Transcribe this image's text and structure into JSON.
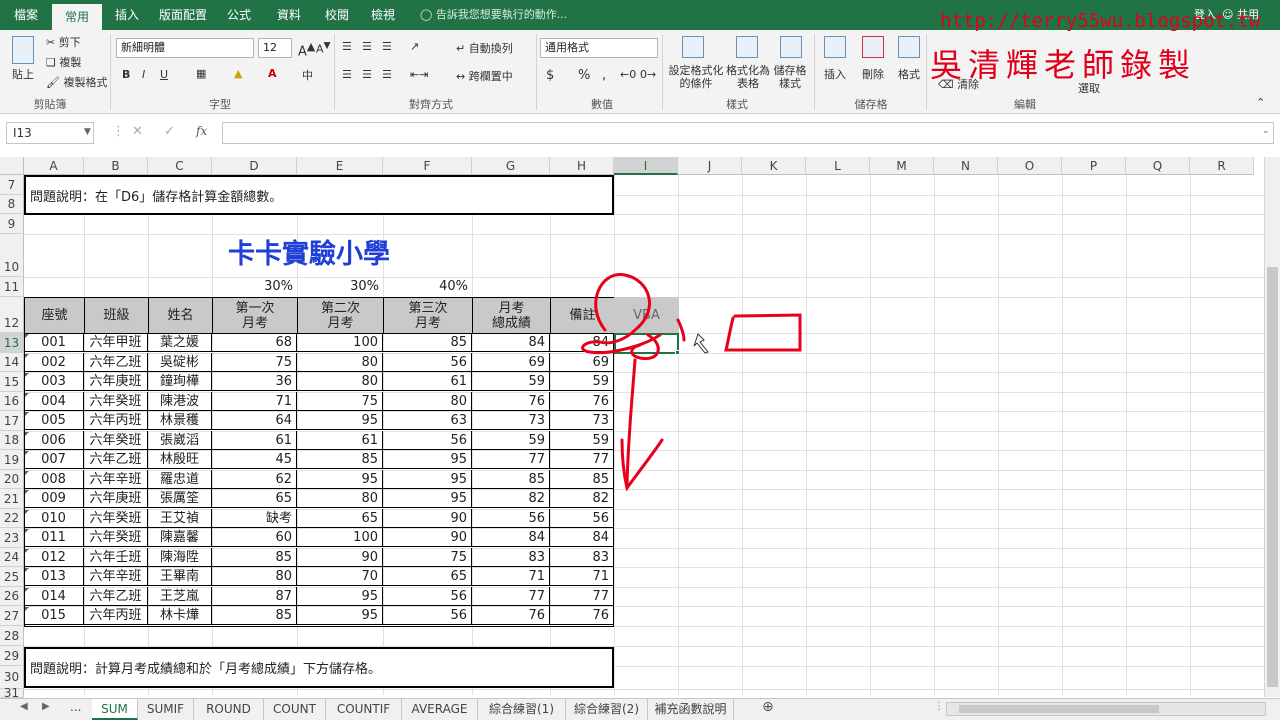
{
  "tabs": [
    "檔案",
    "常用",
    "插入",
    "版面配置",
    "公式",
    "資料",
    "校閱",
    "檢視"
  ],
  "active_tab": "常用",
  "tell_me": "告訴我您想要執行的動作...",
  "login": "登入",
  "share": "共用",
  "watermark_url": "http://terry55wu.blogspot.tw",
  "watermark_name": "吳清輝老師錄製",
  "ribbon": {
    "paste": "貼上",
    "cut": "剪下",
    "copy": "複製",
    "format_painter": "複製格式",
    "clipboard": "剪貼簿",
    "font_name": "新細明體",
    "font_size": "12",
    "font_group": "字型",
    "wrap": "自動換列",
    "merge": "跨欄置中",
    "align_group": "對齊方式",
    "num_format": "通用格式",
    "num_group": "數值",
    "cond_format": "設定格式化的條件",
    "table_format": "格式化為表格",
    "cell_style": "儲存格樣式",
    "style_group": "樣式",
    "insert": "插入",
    "delete": "刪除",
    "format": "格式",
    "cells_group": "儲存格",
    "clear": "清除",
    "select": "選取",
    "edit_group": "編輯",
    "bold": "B",
    "italic": "I",
    "underline": "U",
    "currency": "$",
    "percent": "%",
    "comma": ","
  },
  "name_box": "I13",
  "columns": [
    "A",
    "B",
    "C",
    "D",
    "E",
    "F",
    "G",
    "H",
    "I",
    "J",
    "K",
    "L",
    "M",
    "N",
    "O",
    "P",
    "Q",
    "R"
  ],
  "row_numbers": [
    "7",
    "8",
    "9",
    "10",
    "11",
    "12",
    "13",
    "14",
    "15",
    "16",
    "17",
    "18",
    "19",
    "20",
    "21",
    "22",
    "23",
    "24",
    "25",
    "26",
    "27",
    "28",
    "29",
    "30",
    "31"
  ],
  "note_top": "問題說明：在「D6」儲存格計算金額總數。",
  "title": "卡卡實驗小學",
  "weights": [
    "30%",
    "30%",
    "40%"
  ],
  "headers": [
    "座號",
    "班級",
    "姓名",
    "第一次\n月考",
    "第二次\n月考",
    "第三次\n月考",
    "月考\n總成績",
    "備註",
    "VBA"
  ],
  "rows": [
    [
      "001",
      "六年甲班",
      "葉之媛",
      "68",
      "100",
      "85",
      "84",
      "84"
    ],
    [
      "002",
      "六年乙班",
      "吳碇彬",
      "75",
      "80",
      "56",
      "69",
      "69"
    ],
    [
      "003",
      "六年庚班",
      "鐘珣樺",
      "36",
      "80",
      "61",
      "59",
      "59"
    ],
    [
      "004",
      "六年癸班",
      "陳港波",
      "71",
      "75",
      "80",
      "76",
      "76"
    ],
    [
      "005",
      "六年丙班",
      "林景穫",
      "64",
      "95",
      "63",
      "73",
      "73"
    ],
    [
      "006",
      "六年癸班",
      "張崴滔",
      "61",
      "61",
      "56",
      "59",
      "59"
    ],
    [
      "007",
      "六年乙班",
      "林殷旺",
      "45",
      "85",
      "95",
      "77",
      "77"
    ],
    [
      "008",
      "六年辛班",
      "羅忠道",
      "62",
      "95",
      "95",
      "85",
      "85"
    ],
    [
      "009",
      "六年庚班",
      "張厲筌",
      "65",
      "80",
      "95",
      "82",
      "82"
    ],
    [
      "010",
      "六年癸班",
      "王艾禎",
      "缺考",
      "65",
      "90",
      "56",
      "56"
    ],
    [
      "011",
      "六年癸班",
      "陳嘉馨",
      "60",
      "100",
      "90",
      "84",
      "84"
    ],
    [
      "012",
      "六年壬班",
      "陳海陞",
      "85",
      "90",
      "75",
      "83",
      "83"
    ],
    [
      "013",
      "六年辛班",
      "王畢南",
      "80",
      "70",
      "65",
      "71",
      "71"
    ],
    [
      "014",
      "六年乙班",
      "王芝嵐",
      "87",
      "95",
      "56",
      "77",
      "77"
    ],
    [
      "015",
      "六年丙班",
      "林卡燁",
      "85",
      "95",
      "56",
      "76",
      "76"
    ]
  ],
  "note_bottom": "問題說明：計算月考成績總和於「月考總成績」下方儲存格。",
  "sheets": [
    "SUM",
    "SUMIF",
    "ROUND",
    "COUNT",
    "COUNTIF",
    "AVERAGE",
    "綜合練習(1)",
    "綜合練習(2)",
    "補充函數說明"
  ],
  "active_sheet": "SUM",
  "sheet_more": "...",
  "fx": "fx"
}
